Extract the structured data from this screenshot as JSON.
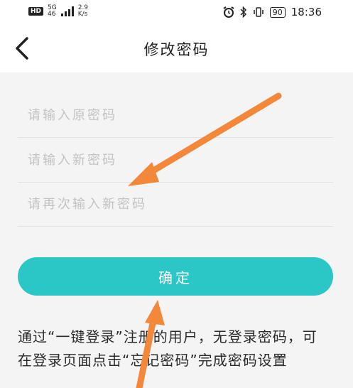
{
  "status_bar": {
    "hd": "HD",
    "network_top": "5G",
    "network_bottom": "46",
    "speed_value": "2.9",
    "speed_unit": "K/s",
    "battery": "90",
    "time": "18:36"
  },
  "header": {
    "title": "修改密码"
  },
  "form": {
    "old_password_placeholder": "请输入原密码",
    "new_password_placeholder": "请输入新密码",
    "confirm_password_placeholder": "请再次输入新密码",
    "confirm_label": "确定"
  },
  "hint": {
    "text": "通过“一键登录”注册的用户，无登录密码，可在登录页面点击“忘记密码”完成密码设置"
  },
  "colors": {
    "accent": "#2bc6c6",
    "annotation_arrow": "#f4883a"
  },
  "icons": {
    "back": "chevron-left-icon",
    "alarm": "alarm-icon",
    "bluetooth": "bluetooth-icon",
    "vibrate": "vibrate-icon"
  }
}
